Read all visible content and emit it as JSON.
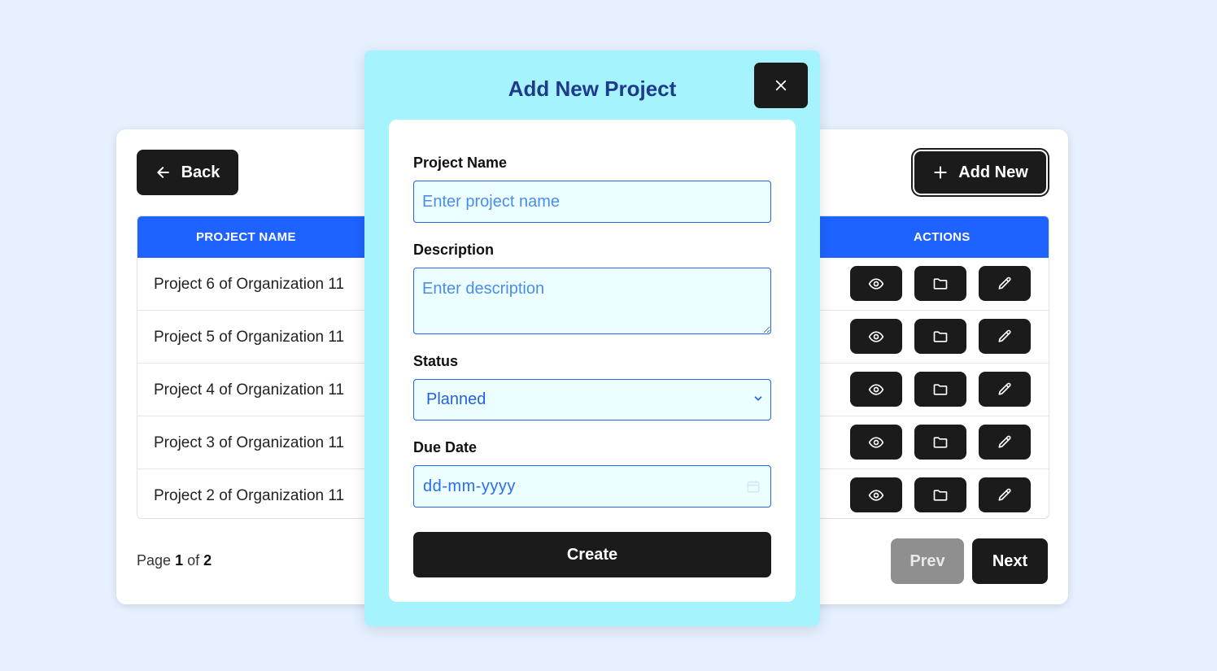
{
  "list": {
    "back_label": "Back",
    "add_new_label": "Add New",
    "columns": {
      "name": "PROJECT NAME",
      "actions": "ACTIONS"
    },
    "rows": [
      {
        "name": "Project 6 of Organization 11"
      },
      {
        "name": "Project 5 of Organization 11"
      },
      {
        "name": "Project 4 of Organization 11"
      },
      {
        "name": "Project 3 of Organization 11"
      },
      {
        "name": "Project 2 of Organization 11"
      }
    ],
    "row_action_icons": [
      "eye-icon",
      "folder-icon",
      "pencil-icon"
    ],
    "pagination": {
      "page_prefix": "Page",
      "current_page": "1",
      "of_word": "of",
      "total_pages": "2",
      "prev_label": "Prev",
      "next_label": "Next"
    }
  },
  "modal": {
    "title": "Add New Project",
    "fields": {
      "name_label": "Project Name",
      "name_placeholder": "Enter project name",
      "description_label": "Description",
      "description_placeholder": "Enter description",
      "status_label": "Status",
      "status_value": "Planned",
      "due_date_label": "Due Date",
      "due_date_placeholder": "dd-mm-yyyy"
    },
    "create_label": "Create"
  },
  "colors": {
    "background": "#e6f0fe",
    "table_header": "#1e63ff",
    "modal_bg": "#a5f3fc",
    "modal_title": "#1e3a8a",
    "dark_button": "#1b1b1b",
    "disabled_button": "#8f8f8f",
    "field_border": "#2563eb",
    "field_bg": "#ecfeff"
  }
}
